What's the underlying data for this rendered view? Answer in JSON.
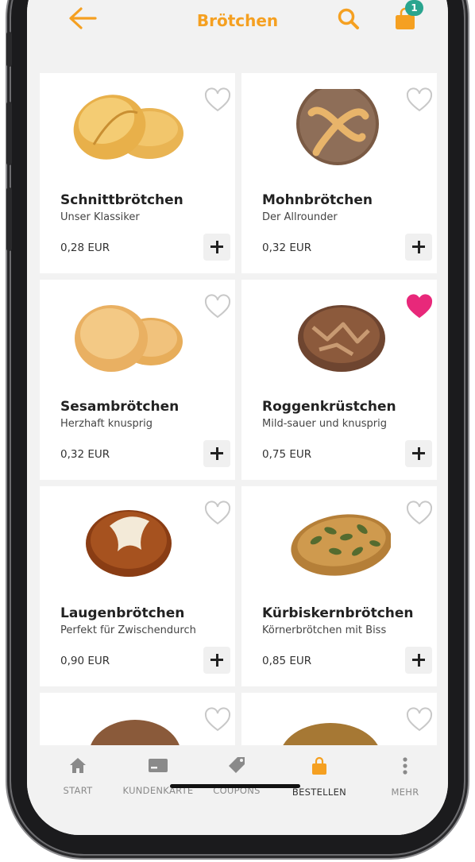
{
  "header": {
    "title": "Brötchen",
    "cart_count": "1",
    "accent_color": "#f5a021"
  },
  "products": [
    {
      "name": "Schnittbrötchen",
      "description": "Unser Klassiker",
      "price": "0,28 EUR",
      "favorite": false
    },
    {
      "name": "Mohnbrötchen",
      "description": "Der Allrounder",
      "price": "0,32 EUR",
      "favorite": false
    },
    {
      "name": "Sesambrötchen",
      "description": "Herzhaft knusprig",
      "price": "0,32 EUR",
      "favorite": false
    },
    {
      "name": "Roggenkrüstchen",
      "description": "Mild-sauer und knusprig",
      "price": "0,75 EUR",
      "favorite": true
    },
    {
      "name": "Laugenbrötchen",
      "description": "Perfekt für Zwischendurch",
      "price": "0,90 EUR",
      "favorite": false
    },
    {
      "name": "Kürbiskernbrötchen",
      "description": "Körnerbrötchen mit Biss",
      "price": "0,85 EUR",
      "favorite": false
    }
  ],
  "tabs": [
    {
      "label": "START",
      "icon": "home-icon"
    },
    {
      "label": "KUNDENKARTE",
      "icon": "card-icon"
    },
    {
      "label": "COUPONS",
      "icon": "tag-icon"
    },
    {
      "label": "BESTELLEN",
      "icon": "bag-icon",
      "active": true
    },
    {
      "label": "MEHR",
      "icon": "more-icon"
    }
  ],
  "colors": {
    "favorite": "#e8287a",
    "badge": "#2aa58f"
  }
}
